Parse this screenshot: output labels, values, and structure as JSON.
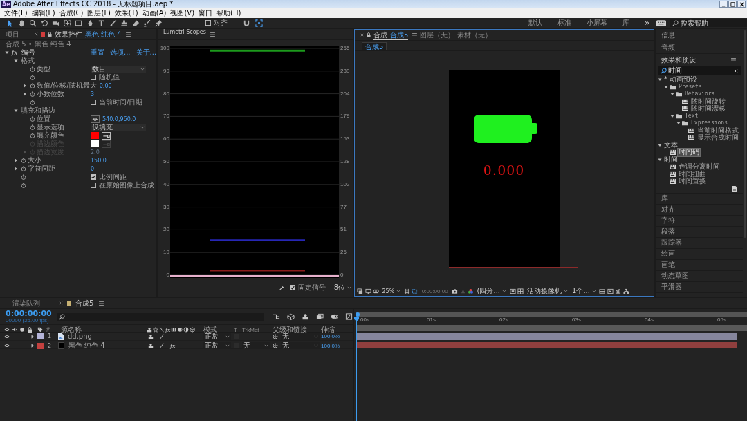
{
  "window": {
    "logo": "Ae",
    "title": "Adobe After Effects CC 2018 - 无标题项目.aep *"
  },
  "menu": [
    "文件(F)",
    "编辑(E)",
    "合成(C)",
    "图层(L)",
    "效果(T)",
    "动画(A)",
    "视图(V)",
    "窗口",
    "帮助(H)"
  ],
  "toolbar": {
    "tools": [
      {
        "kind": "selection",
        "selected": true
      },
      {
        "kind": "hand",
        "selected": false
      },
      {
        "kind": "zoom",
        "selected": false
      },
      {
        "kind": "rotate",
        "selected": false
      },
      {
        "kind": "camera",
        "selected": false
      },
      {
        "kind": "pan-behind",
        "selected": false
      },
      {
        "kind": "rectangle",
        "selected": false
      },
      {
        "kind": "pen",
        "selected": false
      },
      {
        "kind": "type",
        "selected": false
      },
      {
        "kind": "brush",
        "selected": false
      },
      {
        "kind": "stamp",
        "selected": false
      },
      {
        "kind": "eraser",
        "selected": false
      },
      {
        "kind": "roto",
        "selected": false
      },
      {
        "kind": "puppet",
        "selected": false
      }
    ],
    "snap": {
      "label": "对齐",
      "checked": false
    },
    "workspaces": [
      "默认",
      "标准",
      "小屏幕",
      "库"
    ],
    "more": "»",
    "help_search": {
      "placeholder": "搜索帮助"
    }
  },
  "left_panel": {
    "tabs": [
      {
        "label": "项目",
        "selected": false
      },
      {
        "label": "效果控件",
        "target": "黑色 纯色 4",
        "selected": true
      }
    ],
    "breadcrumb": "合成 5 • 黑色 纯色 4",
    "effect": {
      "badge": "fx",
      "name": "编号",
      "expanded": true,
      "links": [
        "重置",
        "选项...",
        "关于..."
      ],
      "properties": [
        {
          "kind": "group",
          "label": "格式",
          "expanded": true,
          "children": [
            {
              "kind": "dropdown",
              "label": "类型",
              "value": "数目"
            },
            {
              "kind": "checkbox",
              "text": "随机值",
              "checked": false
            },
            {
              "kind": "number",
              "label": "数值/位移/随机最大",
              "value": "0.00",
              "expanded": false
            },
            {
              "kind": "number",
              "label": "小数位数",
              "value": "3",
              "expanded": false
            },
            {
              "kind": "checkbox",
              "text": "当前时间/日期",
              "checked": false
            }
          ]
        },
        {
          "kind": "group",
          "label": "填充和描边",
          "expanded": true,
          "children": [
            {
              "kind": "point",
              "label": "位置",
              "value": "540.0,960.0",
              "disabled": false
            },
            {
              "kind": "dropdown",
              "label": "显示选项",
              "value": "仅填充",
              "disabled": false
            },
            {
              "kind": "color",
              "label": "填充颜色",
              "color": "#ff0000",
              "disabled": false
            },
            {
              "kind": "color",
              "label": "描边颜色",
              "color": "#ffffff",
              "disabled": true
            },
            {
              "kind": "number",
              "label": "描边宽度",
              "value": "2.0",
              "expanded": false,
              "disabled": true
            }
          ]
        },
        {
          "kind": "number",
          "label": "大小",
          "value": "150.0",
          "expanded": false
        },
        {
          "kind": "number",
          "label": "字符间距",
          "value": "0",
          "expanded": false
        },
        {
          "kind": "checkbox",
          "text": "比例间距",
          "checked": true
        },
        {
          "kind": "checkbox",
          "text": "在原始图像上合成",
          "checked": false
        }
      ]
    }
  },
  "scopes": {
    "title": "Lumetri Scopes",
    "left_ticks": [
      "100",
      "90",
      "80",
      "70",
      "60",
      "50",
      "40",
      "30",
      "20",
      "10",
      "0"
    ],
    "right_ticks": [
      "255",
      "230",
      "204",
      "179",
      "153",
      "128",
      "102",
      "77",
      "51",
      "26",
      "0"
    ],
    "clamp": {
      "label": "固定信号",
      "checked": true
    },
    "bit_depth": "8位"
  },
  "comp_panel": {
    "tabs": [
      {
        "label": "合成",
        "target": "合成5",
        "selected": true
      },
      {
        "label": "图层（无）",
        "selected": false
      },
      {
        "label": "素材（无）",
        "selected": false
      }
    ],
    "view_tab": "合成5",
    "counter": "0.000",
    "viewer_bar": {
      "zoom": "25%",
      "timecode": "0:00:00:00",
      "channel": "(四分...",
      "camera": "活动摄像机",
      "views": "1个..."
    }
  },
  "right_panel": {
    "panels_top": [
      "信息",
      "音频"
    ],
    "effects": {
      "title": "效果和预设",
      "search": "时间",
      "tree": [
        {
          "kind": "category",
          "label": "* 动画预设",
          "expanded": true,
          "selected": false,
          "children": [
            {
              "kind": "folder",
              "label": "Presets",
              "expanded": true,
              "selected": false,
              "children": [
                {
                  "kind": "folder",
                  "label": "Behaviors",
                  "expanded": true,
                  "selected": false,
                  "children": [
                    {
                      "kind": "preset",
                      "label": "随时间旋转",
                      "selected": false
                    },
                    {
                      "kind": "preset",
                      "label": "随时间漂移",
                      "selected": false
                    }
                  ]
                },
                {
                  "kind": "folder",
                  "label": "Text",
                  "expanded": true,
                  "selected": false,
                  "children": [
                    {
                      "kind": "folder",
                      "label": "Expressions",
                      "expanded": true,
                      "selected": false,
                      "children": [
                        {
                          "kind": "preset",
                          "label": "当前时间格式",
                          "selected": false
                        },
                        {
                          "kind": "preset",
                          "label": "显示合成时间",
                          "selected": false
                        }
                      ]
                    }
                  ]
                }
              ]
            }
          ]
        },
        {
          "kind": "category",
          "label": "文本",
          "expanded": true,
          "selected": false,
          "children": [
            {
              "kind": "effect",
              "label": "时间码",
              "selected": true
            }
          ]
        },
        {
          "kind": "category",
          "label": "时间",
          "expanded": true,
          "selected": false,
          "children": [
            {
              "kind": "effect",
              "label": "色调分离时间",
              "selected": false
            },
            {
              "kind": "effect",
              "label": "时间扭曲",
              "selected": false
            },
            {
              "kind": "effect",
              "label": "时间置换",
              "selected": false
            }
          ]
        }
      ]
    },
    "panels": [
      "库",
      "对齐",
      "字符",
      "段落",
      "跟踪器",
      "绘画",
      "画笔",
      "动态草图",
      "平滑器"
    ]
  },
  "timeline": {
    "tabs": [
      {
        "label": "渲染队列",
        "selected": false
      },
      {
        "label": "合成5",
        "selected": true
      }
    ],
    "timecode": "0:00:00:00",
    "frame_info": "00000 (25.00 fps)",
    "columns": {
      "number": "#",
      "name": "源名称",
      "fx": "fx",
      "mode": "模式",
      "t": "T",
      "trkmat": "TrkMat",
      "parent": "父级和链接",
      "stretch": "伸缩"
    },
    "layers": [
      {
        "visible": true,
        "expanded": false,
        "color": "#b4b4d8",
        "number": "1",
        "kind": "image",
        "name": "dd.png",
        "mode": "正常",
        "parent": "无",
        "stretch": "100.0%"
      },
      {
        "visible": true,
        "expanded": false,
        "color": "#c4413f",
        "number": "2",
        "kind": "solid",
        "name": "黑色 纯色 4",
        "effects": {
          "label": "fx",
          "on": true
        },
        "mode": "正常",
        "trkmat": "无",
        "parent": "无",
        "stretch": "100.0%"
      }
    ],
    "ruler": [
      "00s",
      "01s",
      "02s",
      "03s",
      "04s",
      "05s"
    ]
  }
}
